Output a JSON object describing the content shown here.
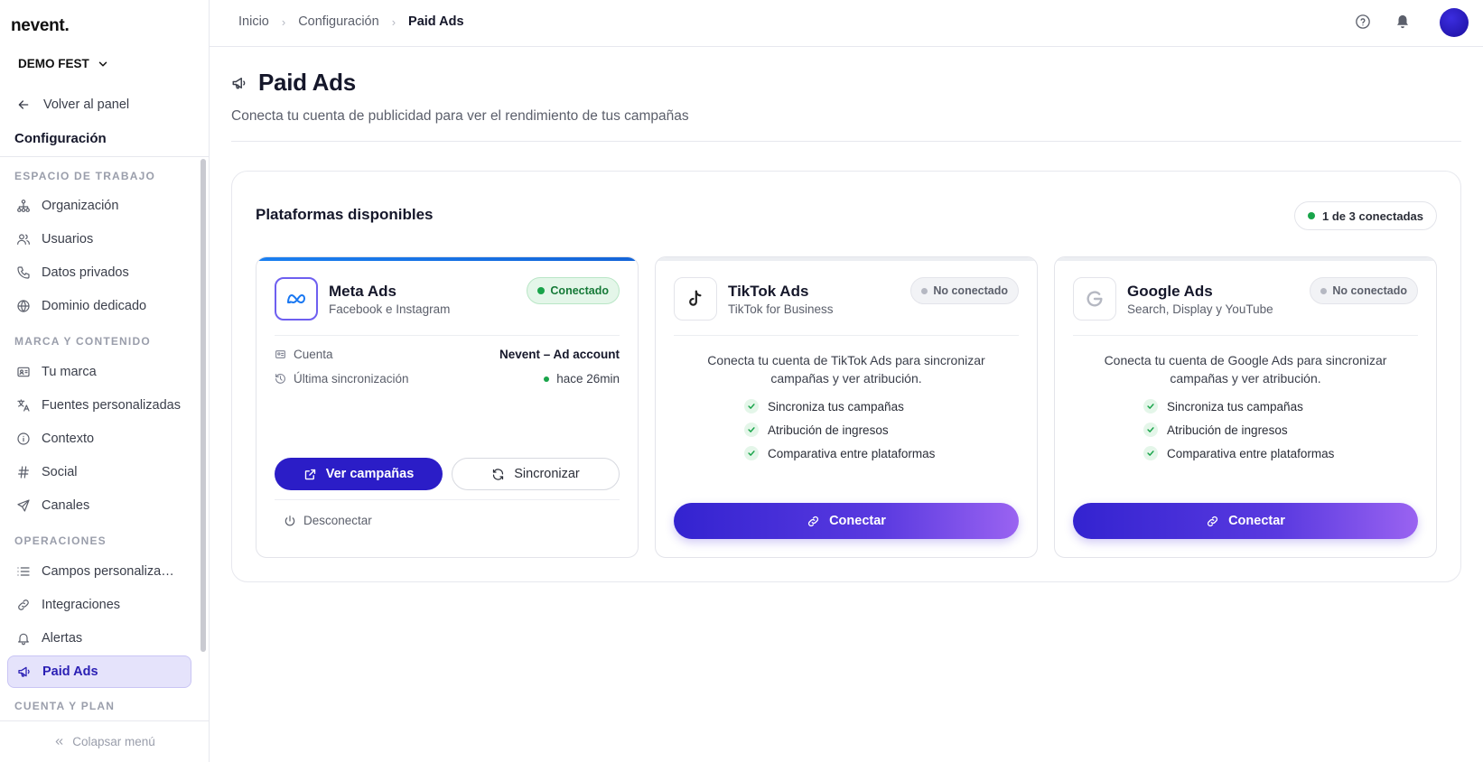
{
  "app": {
    "logo": "nevent."
  },
  "sidebar": {
    "org": "DEMO FEST",
    "back": "Volver al panel",
    "section_title": "Configuración",
    "groups": [
      {
        "label": "ESPACIO DE TRABAJO",
        "items": [
          "Organización",
          "Usuarios",
          "Datos privados",
          "Dominio dedicado"
        ]
      },
      {
        "label": "MARCA Y CONTENIDO",
        "items": [
          "Tu marca",
          "Fuentes personalizadas",
          "Contexto",
          "Social",
          "Canales"
        ]
      },
      {
        "label": "OPERACIONES",
        "items": [
          "Campos personalizados",
          "Integraciones",
          "Alertas",
          "Paid Ads"
        ]
      },
      {
        "label": "CUENTA Y PLAN",
        "items": []
      }
    ],
    "active_item": "Paid Ads",
    "collapse": "Colapsar menú"
  },
  "header": {
    "breadcrumb": [
      "Inicio",
      "Configuración",
      "Paid Ads"
    ]
  },
  "page": {
    "title": "Paid Ads",
    "subtitle": "Conecta tu cuenta de publicidad para ver el rendimiento de tus campañas"
  },
  "panel": {
    "title": "Plataformas disponibles",
    "count": "1 de 3 conectadas"
  },
  "platforms": [
    {
      "name": "Meta Ads",
      "desc": "Facebook e Instagram",
      "status": "Conectado",
      "account_label": "Cuenta",
      "account_value": "Nevent – Ad account",
      "sync_label": "Última sincronización",
      "sync_value": "hace 26min",
      "primary_btn": "Ver campañas",
      "secondary_btn": "Sincronizar",
      "disconnect": "Desconectar"
    },
    {
      "name": "TikTok Ads",
      "desc": "TikTok for Business",
      "status": "No conectado",
      "connect_text": "Conecta tu cuenta de TikTok Ads para sincronizar campañas y ver atribución.",
      "features": [
        "Sincroniza tus campañas",
        "Atribución de ingresos",
        "Comparativa entre plataformas"
      ],
      "connect_btn": "Conectar"
    },
    {
      "name": "Google Ads",
      "desc": "Search, Display y YouTube",
      "status": "No conectado",
      "connect_text": "Conecta tu cuenta de Google Ads para sincronizar campañas y ver atribución.",
      "features": [
        "Sincroniza tus campañas",
        "Atribución de ingresos",
        "Comparativa entre plataformas"
      ],
      "connect_btn": "Conectar"
    }
  ],
  "colors": {
    "primary": "#2b1dc7",
    "connected": "#19a44a",
    "meta_accent": "#1a7ff0"
  },
  "icons": [
    "help-icon",
    "bell-icon",
    "megaphone-icon",
    "meta-logo-icon",
    "tiktok-logo-icon",
    "google-logo-icon"
  ]
}
